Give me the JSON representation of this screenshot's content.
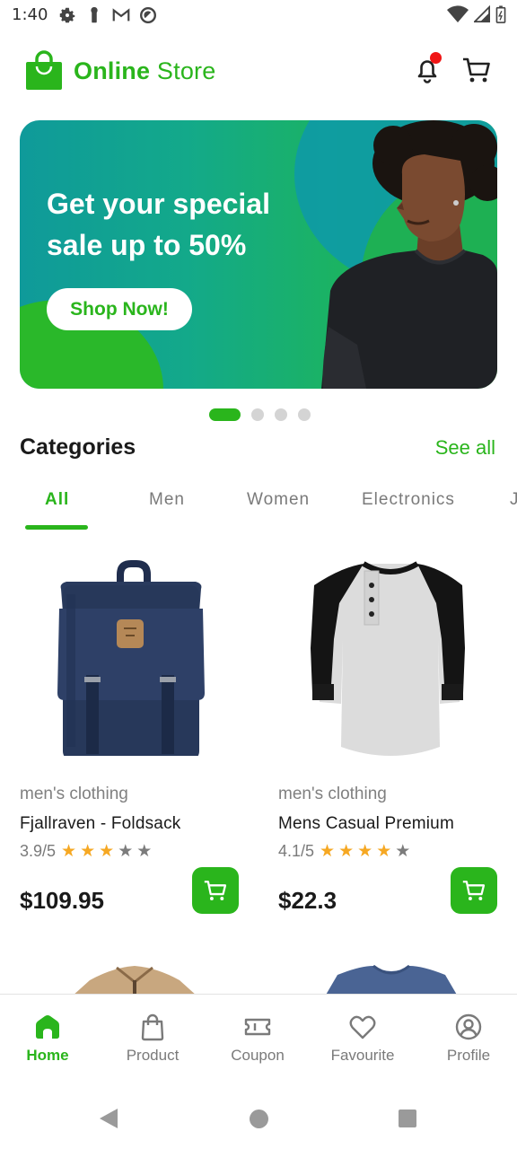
{
  "status_bar": {
    "time": "1:40",
    "left_icons": [
      "settings-icon",
      "key-icon",
      "gmail-icon",
      "do-not-disturb-icon"
    ],
    "right_icons": [
      "wifi-icon",
      "signal-icon",
      "battery-icon"
    ]
  },
  "header": {
    "brand_bold": "Online",
    "brand_regular": "Store",
    "has_notification": true,
    "brand_color": "#2ab51c"
  },
  "banner": {
    "headline": "Get your special sale up to 50%",
    "button_label": "Shop Now!",
    "slides_total": 4,
    "active_slide": 1
  },
  "categories": {
    "title": "Categories",
    "see_all": "See all",
    "tabs": [
      "All",
      "Men",
      "Women",
      "Electronics",
      "J"
    ],
    "active_tab": "All"
  },
  "products": [
    {
      "category": "men's clothing",
      "name": "Fjallraven - Foldsack",
      "rating_text": "3.9/5",
      "stars": 3,
      "price": "$109.95",
      "image_icon": "backpack-icon"
    },
    {
      "category": "men's clothing",
      "name": "Mens Casual Premium",
      "rating_text": "4.1/5",
      "stars": 4,
      "price": "$22.3",
      "image_icon": "tshirt-icon"
    }
  ],
  "bottom_nav": {
    "items": [
      {
        "label": "Home",
        "icon": "home-icon",
        "active": true
      },
      {
        "label": "Product",
        "icon": "shopping-bag-icon",
        "active": false
      },
      {
        "label": "Coupon",
        "icon": "coupon-icon",
        "active": false
      },
      {
        "label": "Favourite",
        "icon": "heart-icon",
        "active": false
      },
      {
        "label": "Profile",
        "icon": "profile-icon",
        "active": false
      }
    ]
  },
  "colors": {
    "accent": "#2ab51c",
    "star": "#f6a823",
    "notification_dot": "#f01515"
  }
}
